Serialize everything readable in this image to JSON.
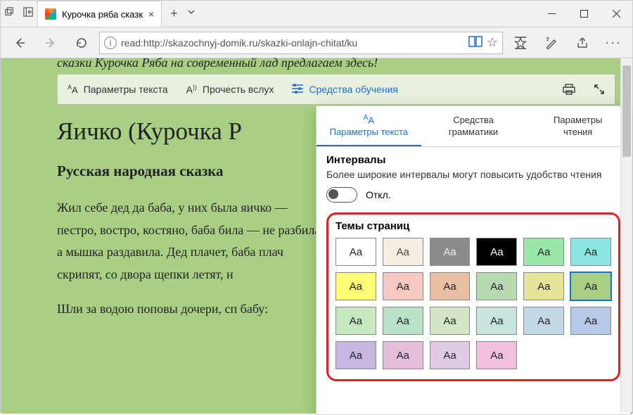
{
  "window": {
    "tab_title": "Курочка ряба сказк",
    "url": "read:http://skazochnyj-domik.ru/skazki-onlajn-chitat/ku"
  },
  "reading_bar": {
    "text_options": "Параметры текста",
    "read_aloud": "Прочесть вслух",
    "learning_tools": "Средства обучения"
  },
  "article": {
    "clipped": "сказки Курочка Ряба на современный лад предлагаем здесь!",
    "h1": "Яичко (Курочка Р",
    "h2": "Русская народная сказка",
    "p1": "Жил себе дед да баба, у них была яичко — пестро, востро, костяно, баба била — не разбила, а мышка раздавила. Дед плачет, баба плач скрипят, со двора щепки летят, н",
    "p2": "Шли за водою поповы дочери, сп бабу:"
  },
  "panel": {
    "tabs": {
      "text": "Параметры текста",
      "grammar_l1": "Средства",
      "grammar_l2": "грамматики",
      "reading_l1": "Параметры",
      "reading_l2": "чтения"
    },
    "intervals": {
      "title": "Интервалы",
      "desc": "Более широкие интервалы могут повысить удобство чтения",
      "state": "Откл."
    },
    "themes": {
      "title": "Темы страниц",
      "sample": "Aa",
      "swatches": [
        {
          "bg": "#ffffff",
          "fg": "#222"
        },
        {
          "bg": "#f6efe1",
          "fg": "#444"
        },
        {
          "bg": "#8c8c8c",
          "fg": "#eee"
        },
        {
          "bg": "#000000",
          "fg": "#fff"
        },
        {
          "bg": "#99e7a8",
          "fg": "#222"
        },
        {
          "bg": "#8de4e4",
          "fg": "#222"
        },
        {
          "bg": "#fffb74",
          "fg": "#222"
        },
        {
          "bg": "#f7c8c1",
          "fg": "#222"
        },
        {
          "bg": "#e9bfa4",
          "fg": "#222"
        },
        {
          "bg": "#b8dab1",
          "fg": "#222"
        },
        {
          "bg": "#e6e39a",
          "fg": "#222"
        },
        {
          "bg": "#a9cf84",
          "fg": "#222",
          "selected": true
        },
        {
          "bg": "#c7e9c0",
          "fg": "#222"
        },
        {
          "bg": "#b8e1c8",
          "fg": "#222"
        },
        {
          "bg": "#d6e5c5",
          "fg": "#222"
        },
        {
          "bg": "#c8e4de",
          "fg": "#222"
        },
        {
          "bg": "#c4d9e6",
          "fg": "#222"
        },
        {
          "bg": "#b8c9e8",
          "fg": "#222"
        },
        {
          "bg": "#c5b6e2",
          "fg": "#222"
        },
        {
          "bg": "#e5bedc",
          "fg": "#222"
        },
        {
          "bg": "#e0cbe6",
          "fg": "#222"
        },
        {
          "bg": "#f3bfe0",
          "fg": "#222"
        }
      ]
    }
  }
}
